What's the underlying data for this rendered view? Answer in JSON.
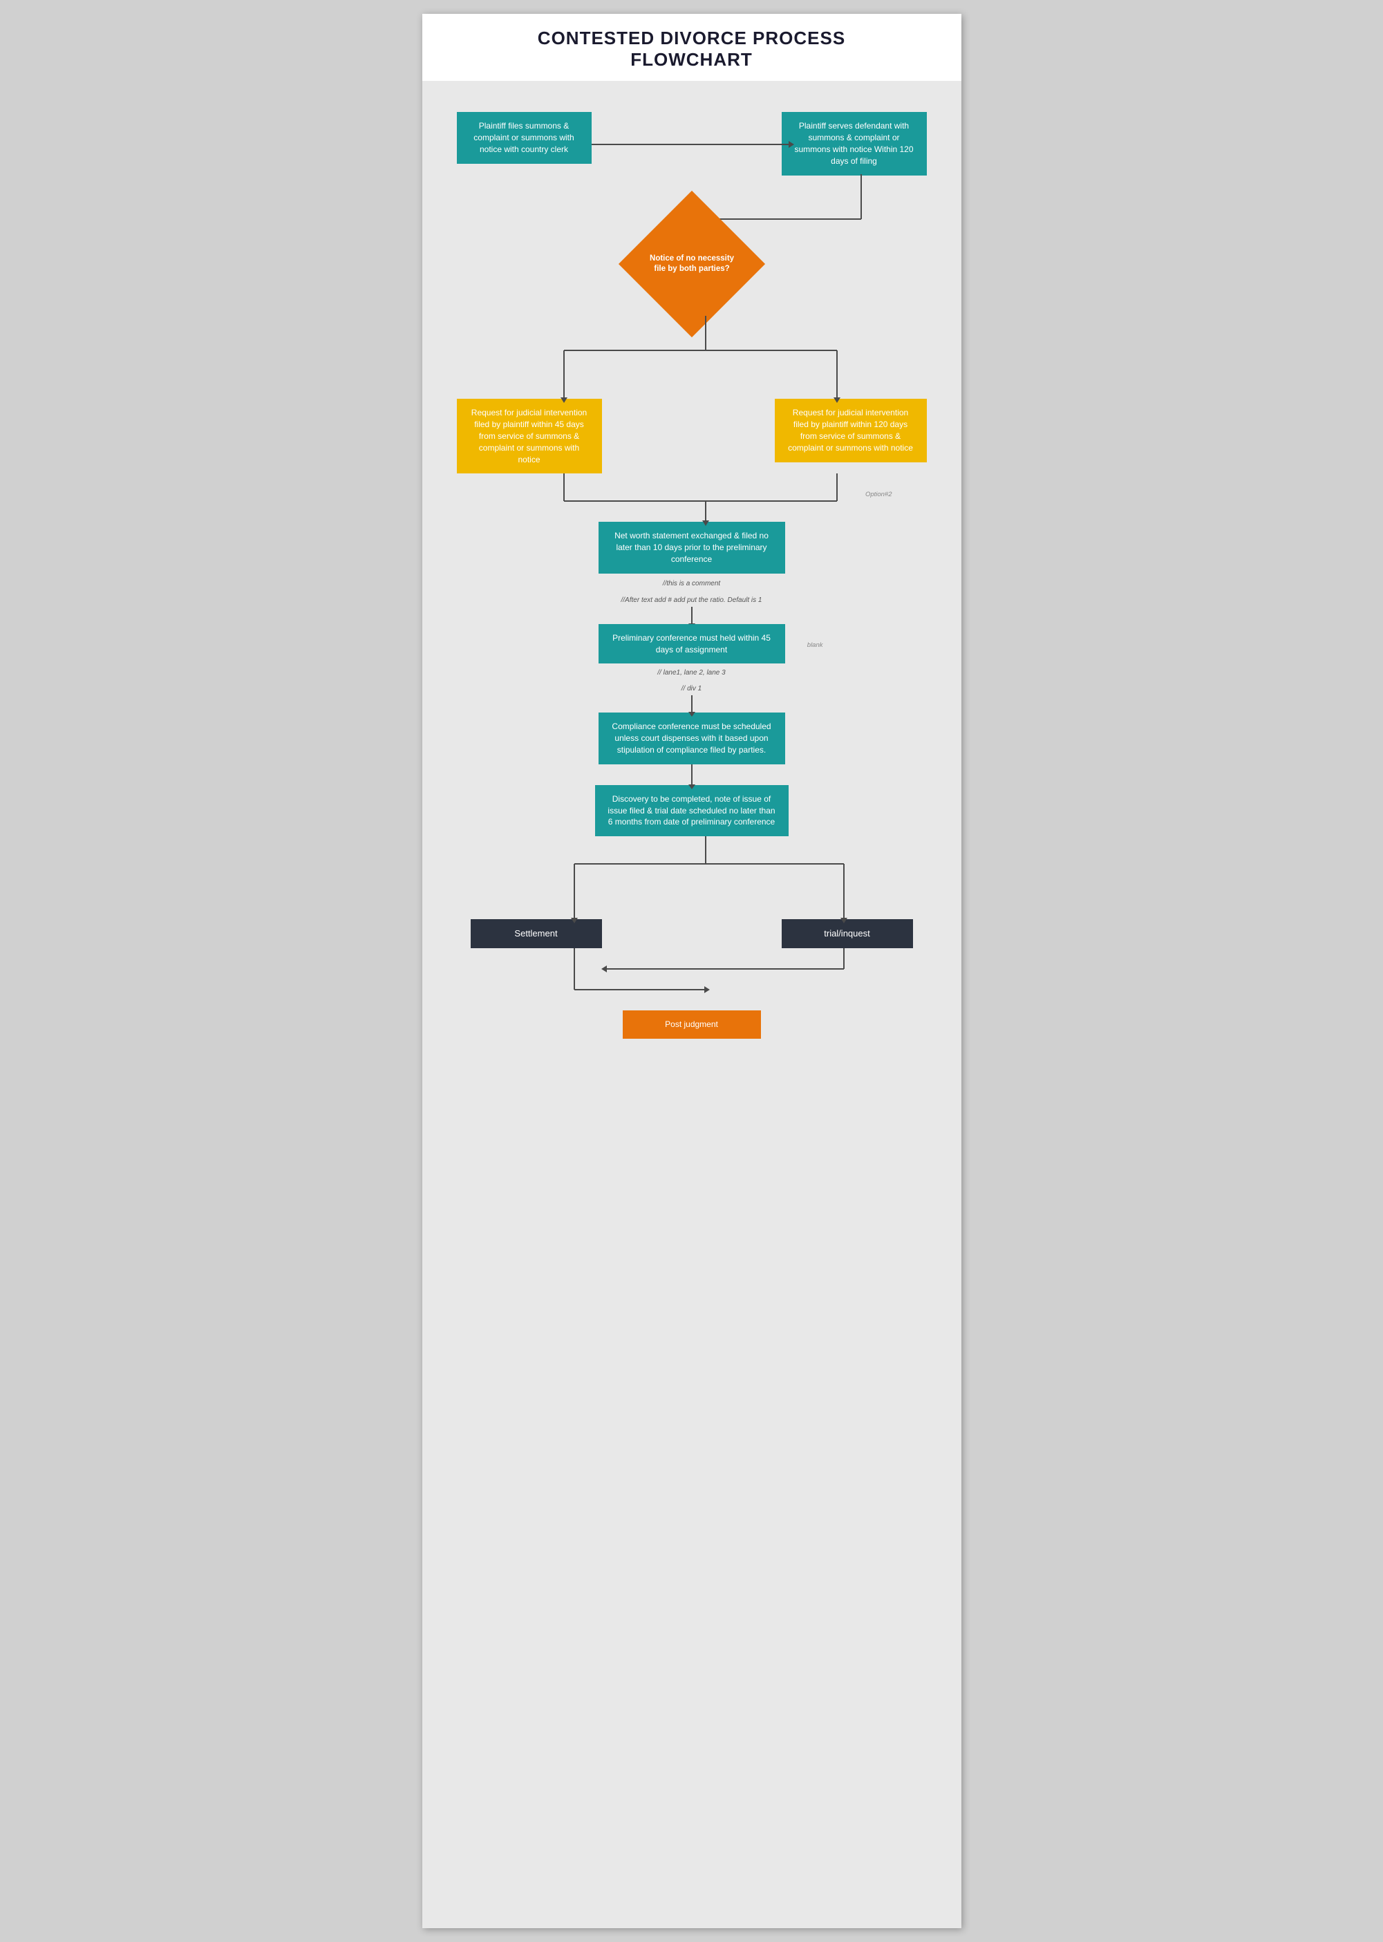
{
  "title": {
    "line1": "CONTESTED DIVORCE PROCESS",
    "line2": "FLOWCHART"
  },
  "nodes": {
    "plaintiff_files": "Plaintiff files summons & complaint or summons with notice with country clerk",
    "plaintiff_serves": "Plaintiff serves defendant with summons & complaint or summons with notice\nWithin 120 days of filing",
    "notice_diamond": "Notice of no necessity file  by both parties?",
    "rji_45days": "Request for judicial intervention filed by plaintiff within 45 days from service of summons & complaint or summons with notice",
    "rji_120days": "Request for judicial intervention filed by plaintiff within 120 days from service of summons & complaint or summons with notice",
    "net_worth": "Net worth statement exchanged & filed no later than 10 days prior to the preliminary conference",
    "preliminary": "Preliminary conference must held within 45 days of assignment",
    "compliance": "Compliance conference must be scheduled unless court dispenses with it based upon stipulation of compliance filed by parties.",
    "discovery": "Discovery to be completed, note of issue of issue filed & trial date scheduled no later than 6 months from date of preliminary conference",
    "settlement": "Settlement",
    "trial": "trial/inquest",
    "post_judgment": "Post judgment"
  },
  "comments": {
    "comment1": "//this is a comment",
    "comment2": "//After text add # add put the ratio. Default is 1",
    "comment3": "// lane1, lane 2, lane 3",
    "comment4": "// div 1",
    "option1": "Option#2",
    "blank_label": "blank"
  },
  "colors": {
    "teal": "#1a9a9a",
    "orange": "#e8730a",
    "yellow": "#f0b800",
    "dark": "#2c3340",
    "arrow": "#4a4a4a",
    "bg": "#e8e8e8",
    "header_bg": "#ffffff"
  }
}
